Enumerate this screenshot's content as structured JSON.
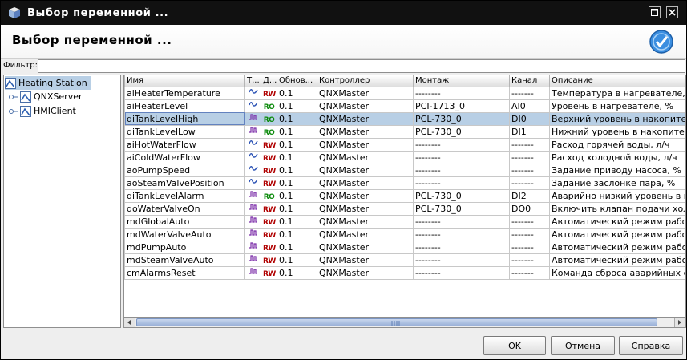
{
  "window": {
    "title": "Выбор переменной ..."
  },
  "header": {
    "title": "Выбор переменной ..."
  },
  "filter": {
    "label": "Фильтр:",
    "value": ""
  },
  "tree": {
    "root": "Heating Station",
    "children": [
      "QNXServer",
      "HMIClient"
    ]
  },
  "table": {
    "columns": [
      "Имя",
      "Т...",
      "Д...",
      "Обнов...",
      "Контроллер",
      "Монтаж",
      "Канал",
      "Описание"
    ],
    "rows": [
      {
        "name": "aiHeaterTemperature",
        "type": "analog",
        "access": "RW",
        "update": "0.1",
        "controller": "QNXMaster",
        "mount": "--------",
        "channel": "-------",
        "desc": "Температура в нагревателе, С"
      },
      {
        "name": "aiHeaterLevel",
        "type": "analog",
        "access": "RO",
        "update": "0.1",
        "controller": "QNXMaster",
        "mount": "PCI-1713_0",
        "channel": "AI0",
        "desc": "Уровень в нагревателе, %"
      },
      {
        "name": "diTankLevelHigh",
        "type": "discrete",
        "access": "RO",
        "update": "0.1",
        "controller": "QNXMaster",
        "mount": "PCL-730_0",
        "channel": "DI0",
        "desc": "Верхний уровень в накопител"
      },
      {
        "name": "diTankLevelLow",
        "type": "discrete",
        "access": "RO",
        "update": "0.1",
        "controller": "QNXMaster",
        "mount": "PCL-730_0",
        "channel": "DI1",
        "desc": "Нижний уровень в накопитель"
      },
      {
        "name": "aiHotWaterFlow",
        "type": "analog",
        "access": "RW",
        "update": "0.1",
        "controller": "QNXMaster",
        "mount": "--------",
        "channel": "-------",
        "desc": "Расход горячей воды, л/ч"
      },
      {
        "name": "aiColdWaterFlow",
        "type": "analog",
        "access": "RW",
        "update": "0.1",
        "controller": "QNXMaster",
        "mount": "--------",
        "channel": "-------",
        "desc": "Расход холодной воды, л/ч"
      },
      {
        "name": "aoPumpSpeed",
        "type": "analog",
        "access": "RW",
        "update": "0.1",
        "controller": "QNXMaster",
        "mount": "--------",
        "channel": "-------",
        "desc": "Задание приводу насоса, %"
      },
      {
        "name": "aoSteamValvePosition",
        "type": "analog",
        "access": "RW",
        "update": "0.1",
        "controller": "QNXMaster",
        "mount": "--------",
        "channel": "-------",
        "desc": "Задание заслонке пара, %"
      },
      {
        "name": "diTankLevelAlarm",
        "type": "discrete",
        "access": "RO",
        "update": "0.1",
        "controller": "QNXMaster",
        "mount": "PCL-730_0",
        "channel": "DI2",
        "desc": "Аварийно низкий уровень в на"
      },
      {
        "name": "doWaterValveOn",
        "type": "discrete",
        "access": "RW",
        "update": "0.1",
        "controller": "QNXMaster",
        "mount": "PCL-730_0",
        "channel": "DO0",
        "desc": "Включить клапан подачи холо"
      },
      {
        "name": "mdGlobalAuto",
        "type": "discrete",
        "access": "RW",
        "update": "0.1",
        "controller": "QNXMaster",
        "mount": "--------",
        "channel": "-------",
        "desc": "Автоматический режим работ"
      },
      {
        "name": "mdWaterValveAuto",
        "type": "discrete",
        "access": "RW",
        "update": "0.1",
        "controller": "QNXMaster",
        "mount": "--------",
        "channel": "-------",
        "desc": "Автоматический режим работ"
      },
      {
        "name": "mdPumpAuto",
        "type": "discrete",
        "access": "RW",
        "update": "0.1",
        "controller": "QNXMaster",
        "mount": "--------",
        "channel": "-------",
        "desc": "Автоматический режим работ"
      },
      {
        "name": "mdSteamValveAuto",
        "type": "discrete",
        "access": "RW",
        "update": "0.1",
        "controller": "QNXMaster",
        "mount": "--------",
        "channel": "-------",
        "desc": "Автоматический режим работ"
      },
      {
        "name": "cmAlarmsReset",
        "type": "discrete",
        "access": "RW",
        "update": "0.1",
        "controller": "QNXMaster",
        "mount": "--------",
        "channel": "-------",
        "desc": "Команда сброса аварийных с"
      }
    ],
    "selected_index": 2
  },
  "buttons": {
    "ok": "OK",
    "cancel": "Отмена",
    "help": "Справка"
  },
  "colors": {
    "rw": "#b00000",
    "ro": "#0a8a0a",
    "selection": "#b8cfe5",
    "titlebar": "#111111"
  },
  "icons": {
    "analog": "analog-signal-icon",
    "discrete": "discrete-signal-icon"
  }
}
